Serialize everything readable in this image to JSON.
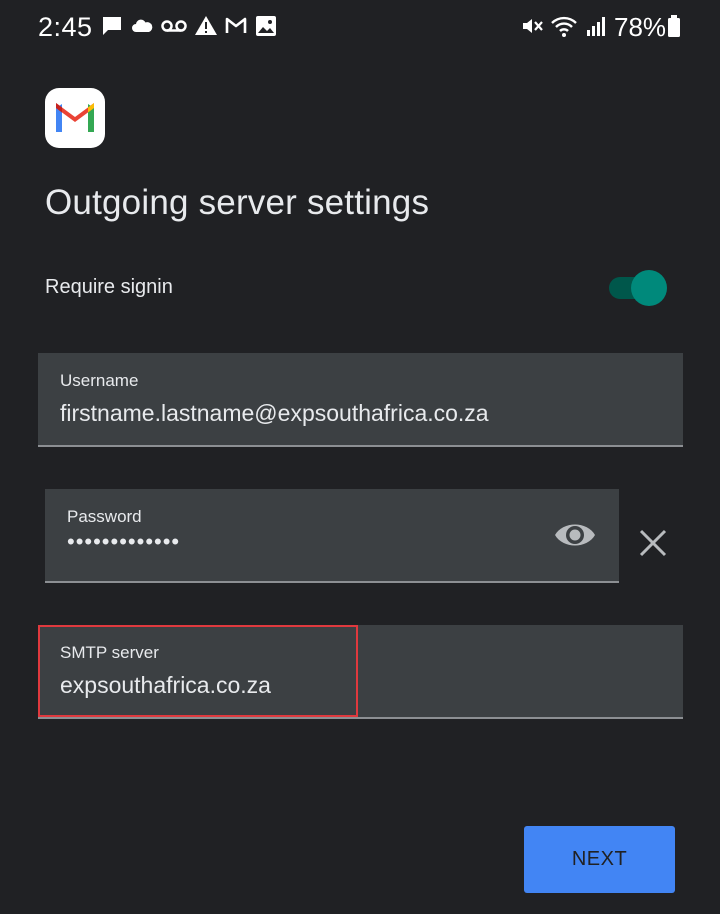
{
  "status_bar": {
    "time": "2:45",
    "battery_percent": "78%",
    "left_icons": [
      "chat-bubble-icon",
      "cloud-icon",
      "voicemail-icon",
      "warning-icon",
      "gmail-notification-icon",
      "image-icon"
    ],
    "right_icons": [
      "vibrate-mute-icon",
      "wifi-icon",
      "signal-icon",
      "battery-icon"
    ]
  },
  "app": {
    "logo": "gmail-logo-icon"
  },
  "page": {
    "title": "Outgoing server settings"
  },
  "require_signin": {
    "label": "Require signin",
    "enabled": true
  },
  "fields": {
    "username": {
      "label": "Username",
      "value": "firstname.lastname@expsouthafrica.co.za"
    },
    "password": {
      "label": "Password",
      "value": "•••••••••••••"
    },
    "smtp_server": {
      "label": "SMTP server",
      "value": "expsouthafrica.co.za"
    }
  },
  "actions": {
    "next_label": "NEXT"
  },
  "colors": {
    "background": "#202124",
    "field_bg": "#3c4043",
    "accent_teal": "#00897b",
    "button_blue": "#4285f4",
    "highlight_red": "#e0393e"
  }
}
